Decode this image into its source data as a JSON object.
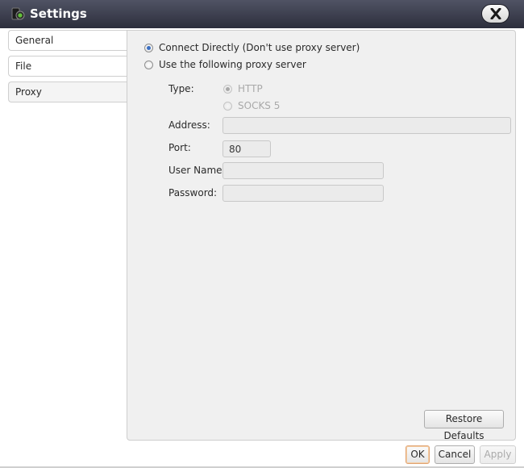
{
  "window": {
    "title": "Settings"
  },
  "sidebar": {
    "tabs": [
      {
        "label": "General"
      },
      {
        "label": "File"
      },
      {
        "label": "Proxy"
      }
    ]
  },
  "proxy": {
    "connect_directly_label": "Connect Directly (Don't use proxy server)",
    "use_proxy_label": "Use the following proxy server",
    "selected_mode": "Connect Directly",
    "type_label": "Type:",
    "type_options": [
      "HTTP",
      "SOCKS 5"
    ],
    "selected_type": "HTTP",
    "address_label": "Address:",
    "address_value": "",
    "port_label": "Port:",
    "port_value": "80",
    "username_label": "User Name:",
    "username_value": "",
    "password_label": "Password:",
    "password_value": ""
  },
  "buttons": {
    "restore_defaults": "Restore Defaults",
    "ok": "OK",
    "cancel": "Cancel",
    "apply": "Apply"
  },
  "colors": {
    "titlebar": "#3a3c4c",
    "panel": "#f0f0f0",
    "radio_selected": "#3b6fc2",
    "ok_focus_border": "#e0a373"
  },
  "icons": {
    "app": "camera-app-icon",
    "close": "close-icon"
  }
}
